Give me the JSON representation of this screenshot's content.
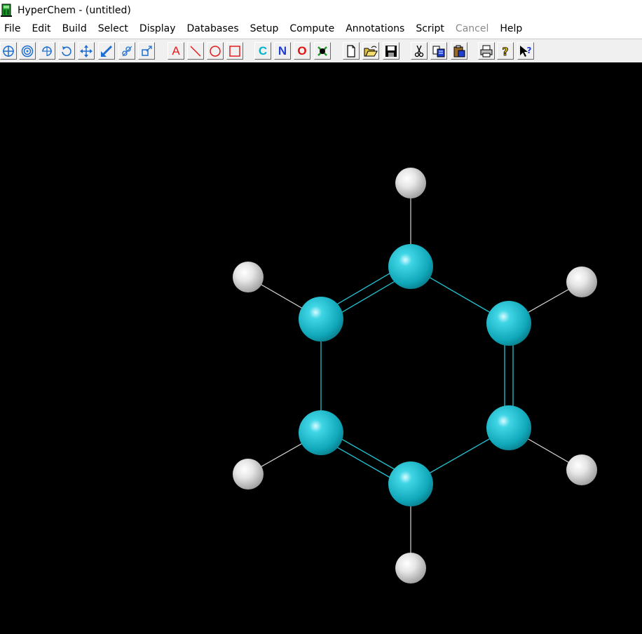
{
  "window": {
    "title": "HyperChem - (untitled)"
  },
  "menu": {
    "items": [
      "File",
      "Edit",
      "Build",
      "Select",
      "Display",
      "Databases",
      "Setup",
      "Compute",
      "Annotations",
      "Script",
      "Cancel",
      "Help"
    ],
    "disabled": [
      "Cancel"
    ]
  },
  "toolbar": {
    "tools": [
      {
        "name": "select-tool",
        "icon": "select-icon"
      },
      {
        "name": "draw-tool",
        "icon": "draw-icon"
      },
      {
        "name": "xy-rotate-tool",
        "icon": "xy-rotate-icon"
      },
      {
        "name": "z-rotate-tool",
        "icon": "z-rotate-icon"
      },
      {
        "name": "xy-translate-tool",
        "icon": "xy-translate-icon"
      },
      {
        "name": "z-translate-tool",
        "icon": "z-translate-icon"
      },
      {
        "name": "zoom-tool",
        "icon": "zoom-icon"
      },
      {
        "name": "clip-tool",
        "icon": "clip-icon"
      }
    ],
    "annotation_tools": {
      "text": "A",
      "line": "line-icon",
      "ellipse": "ellipse-icon",
      "rectangle": "rectangle-icon"
    },
    "elements": {
      "carbon": "C",
      "nitrogen": "N",
      "oxygen": "O",
      "periodic_table": "periodic-table-icon"
    },
    "file": [
      "new-file-icon",
      "open-folder-icon",
      "save-icon"
    ],
    "edit": [
      "cut-icon",
      "copy-icon",
      "paste-icon"
    ],
    "misc": [
      "print-icon",
      "help-icon",
      "context-help-icon"
    ]
  },
  "colors": {
    "workspace_bg": "#000000",
    "carbon": "#1fbfd0",
    "hydrogen": "#d9d9d9",
    "bond": "#23c6d6",
    "annotation_red": "#e31b1b",
    "element_c": "#00b4c8",
    "element_n": "#1f3fd0",
    "element_o": "#e01010"
  },
  "molecule": {
    "name": "benzene"
  }
}
